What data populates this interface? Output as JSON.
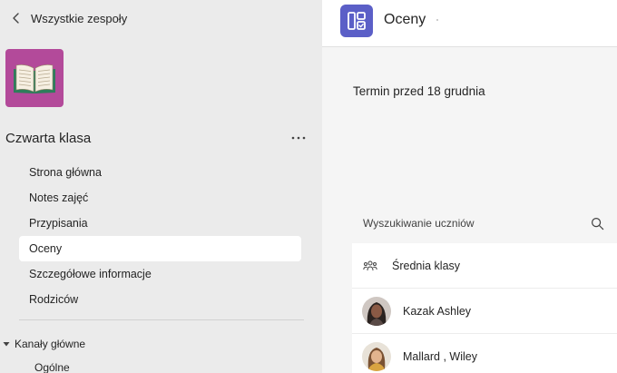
{
  "back": {
    "label": "Wszystkie zespoły"
  },
  "team": {
    "name": "Czwarta klasa",
    "tile_color": "#b34a9a",
    "icon": "open-book-icon"
  },
  "nav": {
    "items": [
      {
        "label": "Strona główna",
        "active": false
      },
      {
        "label": "Notes zajęć",
        "active": false
      },
      {
        "label": "Przypisania",
        "active": false
      },
      {
        "label": "Oceny",
        "active": true
      },
      {
        "label": "Szczegółowe informacje",
        "active": false
      },
      {
        "label": "Rodziców",
        "active": false
      }
    ]
  },
  "channels": {
    "section_label": "Kanały główne",
    "items": [
      {
        "label": "Ogólne"
      }
    ]
  },
  "app": {
    "title": "Oceny",
    "icon_color": "#5b5fc7"
  },
  "main": {
    "due_label": "Termin przed 18 grudnia",
    "search_placeholder": "Wyszukiwanie uczniów",
    "class_average_label": "Średnia klasy",
    "students": [
      {
        "name": "Kazak Ashley"
      },
      {
        "name": "Mallard , Wiley"
      }
    ]
  }
}
